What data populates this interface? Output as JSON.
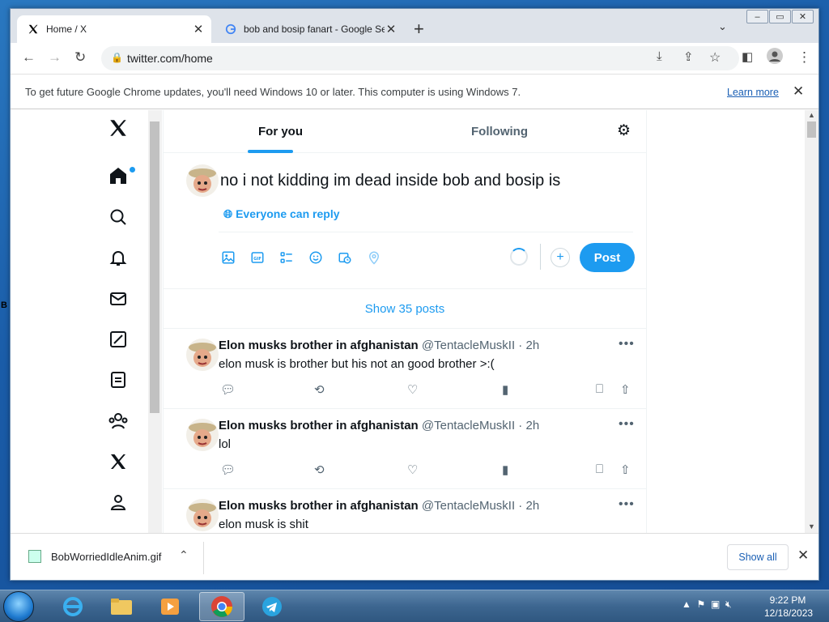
{
  "browser": {
    "tabs": [
      {
        "title": "Home / X",
        "active": true
      },
      {
        "title": "bob and bosip fanart - Google Se",
        "active": false
      }
    ],
    "url": "twitter.com/home",
    "infobar": {
      "message": "To get future Google Chrome updates, you'll need Windows 10 or later. This computer is using Windows 7.",
      "link": "Learn more"
    }
  },
  "twitter": {
    "feed_tabs": [
      "For you",
      "Following"
    ],
    "compose": {
      "text": "no i not kidding im dead inside bob and bosip is",
      "reply_setting": "Everyone can reply",
      "post_label": "Post"
    },
    "show_posts": "Show 35 posts",
    "tweets": [
      {
        "name": "Elon musks brother in afghanistan",
        "meta": "@TentacleMuskII · 2h",
        "text": "elon musk is brother but his not an good brother >:("
      },
      {
        "name": "Elon musks brother in afghanistan",
        "meta": "@TentacleMuskII · 2h",
        "text": "lol"
      },
      {
        "name": "Elon musks brother in afghanistan",
        "meta": "@TentacleMuskII · 2h",
        "text": "elon musk is shit"
      }
    ]
  },
  "downloads": {
    "file": "BobWorriedIdleAnim.gif",
    "show_all": "Show all"
  },
  "taskbar": {
    "time": "9:22 PM",
    "date": "12/18/2023"
  },
  "colors": {
    "accent": "#1d9bf0",
    "text": "#0f1419",
    "muted": "#536471"
  }
}
